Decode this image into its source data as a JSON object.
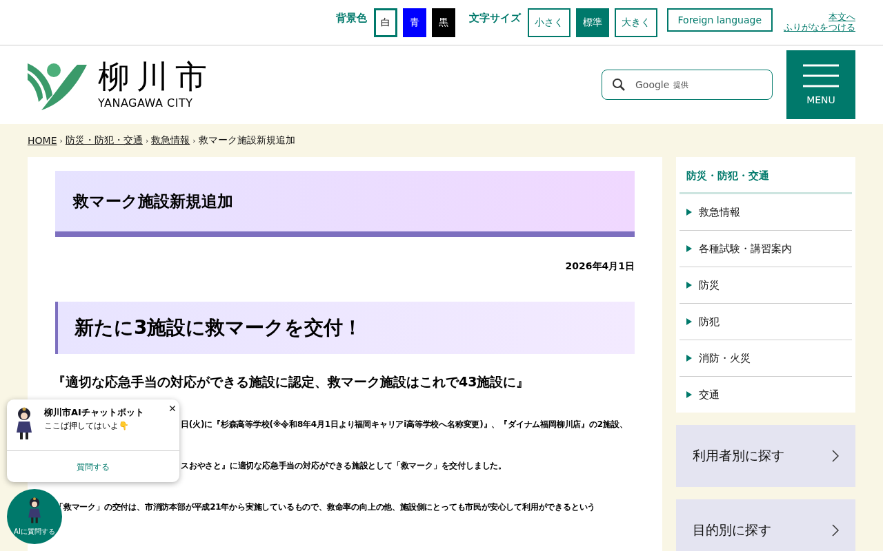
{
  "topbar": {
    "bg_label": "背景色",
    "bg_options": [
      {
        "label": "白",
        "kind": "white",
        "selected": true
      },
      {
        "label": "青",
        "kind": "blue",
        "selected": false
      },
      {
        "label": "黒",
        "kind": "black",
        "selected": false
      }
    ],
    "size_label": "文字サイズ",
    "size_options": [
      {
        "label": "小さく",
        "selected": false
      },
      {
        "label": "標準",
        "selected": true
      },
      {
        "label": "大きく",
        "selected": false
      }
    ],
    "foreign": "Foreign language",
    "furigana": [
      "本文へ",
      "ふりがなをつける"
    ]
  },
  "header": {
    "logo_title": "柳川市",
    "logo_sub": "YANAGAWA CITY",
    "search": {
      "placeholder": "Google",
      "note": "提供"
    },
    "menu": "MENU"
  },
  "breadcrumb_separator": "›",
  "breadcrumb": [
    {
      "label": "HOME",
      "link": true
    },
    {
      "label": "防災・防犯・交通",
      "link": true
    },
    {
      "label": "救急情報",
      "link": true
    },
    {
      "label": "救マーク施設新規追加",
      "link": false
    }
  ],
  "article": {
    "title": "救マーク施設新規追加",
    "date": "2026年4月1日",
    "heading": "新たに3施設に救マークを交付！",
    "subheading": "『適切な応急手当の対応ができる施設に認定、救マーク施設はこれで43施設に』",
    "lines": [
      {
        "text": "日(火)に『杉森高等学校(※令和8年4月1日より福岡キャリアi高等学校へ名称変更)』、『ダイナム福岡柳川店』の2施設、",
        "covered": true
      },
      {
        "text": "スおやさと』に適切な応急手当の対応ができる施設として「救マーク」を交付しました。",
        "covered": true
      },
      {
        "text": "「救マーク」の交付は、市消防本部が平成21年から実施しているもので、救命率の向上の他、施設側にとっても市民が安心して利用ができるという",
        "covered": false
      }
    ]
  },
  "sidebar": {
    "title": "防災・防犯・交通",
    "items": [
      "救急情報",
      "各種試験・講習案内",
      "防災",
      "防犯",
      "消防・火災",
      "交通"
    ],
    "finders": [
      "利用者別に探す",
      "目的別に探す"
    ]
  },
  "chatbot": {
    "title": "柳川市AIチャットボット",
    "message": "ここば押してはいよ👇",
    "action": "質問する",
    "fab": "AIに質問する"
  }
}
